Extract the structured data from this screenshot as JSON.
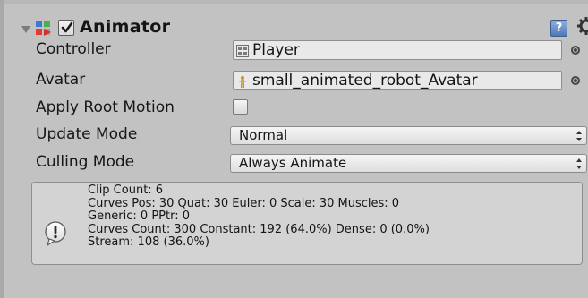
{
  "component": {
    "title": "Animator",
    "enabled": true
  },
  "properties": {
    "controller": {
      "label": "Controller",
      "value": "Player"
    },
    "avatar": {
      "label": "Avatar",
      "value": "small_animated_robot_Avatar"
    },
    "apply_root_motion": {
      "label": "Apply Root Motion",
      "checked": false
    },
    "update_mode": {
      "label": "Update Mode",
      "value": "Normal"
    },
    "culling_mode": {
      "label": "Culling Mode",
      "value": "Always Animate"
    }
  },
  "info": {
    "lines": [
      "Clip Count: 6",
      "Curves Pos: 30 Quat: 30 Euler: 0 Scale: 30 Muscles: 0",
      "Generic: 0 PPtr: 0",
      "Curves Count: 300 Constant: 192 (64.0%) Dense: 0 (0.0%)",
      "Stream: 108 (36.0%)"
    ]
  },
  "colors": {
    "background": "#c2c2c2",
    "field": "#e9e9e9",
    "infobox": "#d3d3d3",
    "text": "#141414"
  },
  "icons": {
    "foldout": "triangle-down-icon",
    "component": "animator-icon",
    "help": "help-book-icon",
    "settings": "gear-icon",
    "controller": "animator-controller-icon",
    "avatar": "avatar-figure-icon",
    "picker": "object-picker-icon",
    "info": "info-exclamation-icon"
  }
}
